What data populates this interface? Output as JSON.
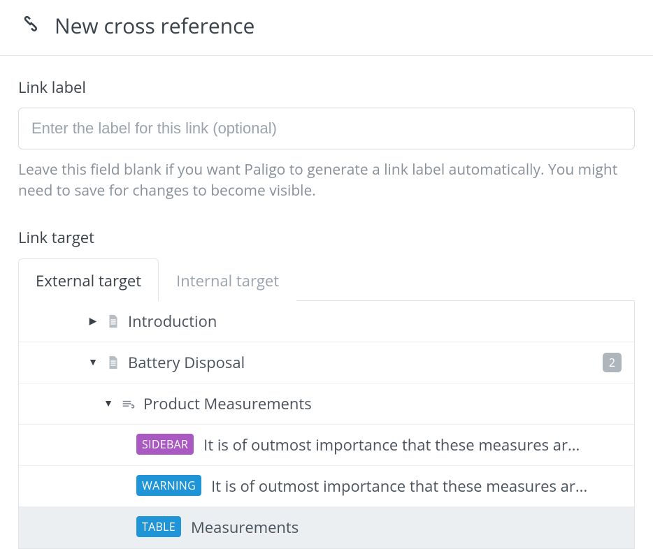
{
  "header": {
    "title": "New cross reference"
  },
  "linkLabel": {
    "label": "Link label",
    "placeholder": "Enter the label for this link (optional)",
    "help": "Leave this field blank if you want Paligo to generate a link label automatically. You might need to save for changes to become visible."
  },
  "linkTarget": {
    "label": "Link target",
    "tabs": {
      "external": "External target",
      "internal": "Internal target"
    },
    "rows": {
      "intro": {
        "label": "Introduction"
      },
      "battery": {
        "label": "Battery Disposal",
        "count": "2"
      },
      "measurements": {
        "label": "Product Measurements"
      },
      "sidebar": {
        "badge": "SIDEBAR",
        "text": "It is of outmost importance that these measures ar..."
      },
      "warning": {
        "badge": "WARNING",
        "text": "It is of outmost importance that these measures ar..."
      },
      "table": {
        "badge": "TABLE",
        "text": "Measurements"
      }
    }
  }
}
